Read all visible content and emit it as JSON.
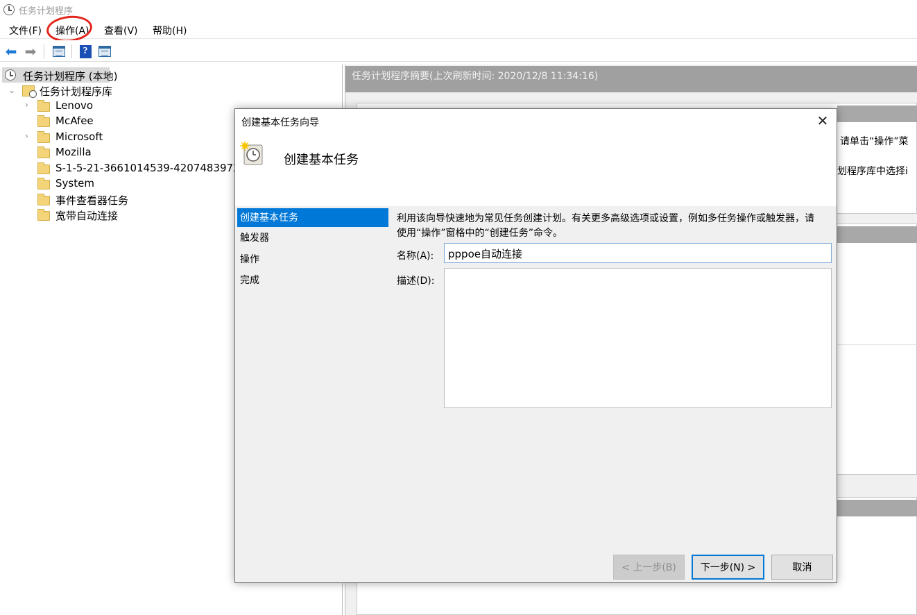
{
  "window": {
    "title": "任务计划程序",
    "icon": "clock-icon"
  },
  "menu": {
    "items": [
      "文件(F)",
      "操作(A)",
      "查看(V)",
      "帮助(H)"
    ],
    "highlighted": "操作(A)",
    "annotation_color": "#e2261b"
  },
  "toolbar": {
    "buttons": [
      "back-arrow-icon",
      "forward-arrow-icon",
      "show-pane-icon",
      "help-icon",
      "action-pane-icon"
    ],
    "help_glyph": "?"
  },
  "tree": {
    "root": "任务计划程序 (本地)",
    "library": "任务计划程序库",
    "items": [
      {
        "label": "Lenovo",
        "expandable": true
      },
      {
        "label": "McAfee",
        "expandable": false
      },
      {
        "label": "Microsoft",
        "expandable": true
      },
      {
        "label": "Mozilla",
        "expandable": false
      },
      {
        "label": "S-1-5-21-3661014539-4207483972-",
        "expandable": false
      },
      {
        "label": "System",
        "expandable": false
      },
      {
        "label": "事件查看器任务",
        "expandable": false
      },
      {
        "label": "宽带自动连接",
        "expandable": false
      }
    ]
  },
  "summary": {
    "header": "任务计划程序摘要(上次刷新时间: 2020/12/8 11:34:16)",
    "partial_text_1": "请单击“操作”菜",
    "partial_text_2": "划程序库中选择i"
  },
  "dialog": {
    "title": "创建基本任务向导",
    "close_glyph": "✕",
    "heading": "创建基本任务",
    "steps": [
      "创建基本任务",
      "触发器",
      "操作",
      "完成"
    ],
    "selected_step": "创建基本任务",
    "description": "利用该向导快速地为常见任务创建计划。有关更多高级选项或设置，例如多任务操作或触发器，请使用“操作”窗格中的“创建任务”命令。",
    "name_label": "名称(A):",
    "name_value": "pppoe自动连接",
    "desc_label": "描述(D):",
    "desc_value": "",
    "buttons": {
      "back": "< 上一步(B)",
      "next": "下一步(N) >",
      "cancel": "取消"
    }
  },
  "colors": {
    "selection": "#0078d7",
    "header_gray": "#a0a0a0",
    "dialog_bg": "#f0f0f0"
  }
}
